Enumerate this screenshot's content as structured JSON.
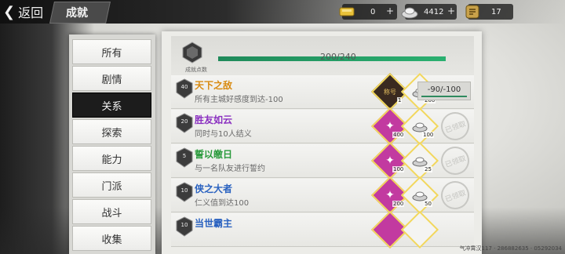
{
  "topbar": {
    "back_label": "返回",
    "title": "成就",
    "resources": [
      {
        "icon": "gold-bar-icon",
        "value": "0"
      },
      {
        "icon": "silver-ingot-icon",
        "value": "4412"
      },
      {
        "icon": "scroll-token-icon",
        "value": "17"
      }
    ]
  },
  "sidebar": {
    "items": [
      "所有",
      "剧情",
      "关系",
      "探索",
      "能力",
      "门派",
      "战斗",
      "收集"
    ],
    "active_index": 2
  },
  "progress": {
    "points_label": "成就点数",
    "text": "200/240",
    "fraction": 1.0
  },
  "achievements": [
    {
      "name": "天下之敌",
      "name_color": "#d88a10",
      "medal": "40",
      "desc": "所有主城好感度到达-100",
      "rewards": [
        {
          "type": "title-badge-icon",
          "qty": "1"
        },
        {
          "type": "silver-ingot-icon",
          "qty": "200"
        }
      ],
      "status": "progress",
      "progress_text": "-90/-100"
    },
    {
      "name": "胜友如云",
      "name_color": "#8a2fc0",
      "medal": "20",
      "desc": "同时与10人结义",
      "rewards": [
        {
          "type": "jade-token-icon",
          "qty": "400"
        },
        {
          "type": "silver-ingot-icon",
          "qty": "100"
        }
      ],
      "status": "claimed",
      "stamp_text": "已领取"
    },
    {
      "name": "誓以皦日",
      "name_color": "#2a9a3c",
      "medal": "5",
      "desc": "与一名队友进行誓约",
      "rewards": [
        {
          "type": "jade-token-icon",
          "qty": "100"
        },
        {
          "type": "silver-ingot-icon",
          "qty": "25"
        }
      ],
      "status": "claimed",
      "stamp_text": "已领取"
    },
    {
      "name": "侠之大者",
      "name_color": "#2a62c0",
      "medal": "10",
      "desc": "仁义值到达100",
      "rewards": [
        {
          "type": "jade-token-icon",
          "qty": "200"
        },
        {
          "type": "silver-ingot-icon",
          "qty": "50"
        }
      ],
      "status": "claimed",
      "stamp_text": "已领取"
    },
    {
      "name": "当世霸主",
      "name_color": "#2a62c0",
      "medal": "10",
      "desc": "",
      "rewards": [
        {
          "type": "jade-token-icon",
          "qty": ""
        },
        {
          "type": "silver-ingot-icon",
          "qty": ""
        }
      ],
      "status": "claimed",
      "stamp_text": ""
    }
  ],
  "watermark": "气冲霄汉117 · 286882635 · 05292034"
}
